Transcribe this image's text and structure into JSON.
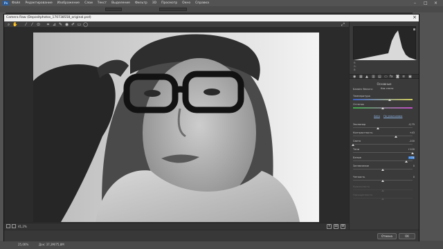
{
  "photoshop": {
    "logo": "Ps",
    "menu": [
      "Файл",
      "Редактирование",
      "Изображение",
      "Слои",
      "Текст",
      "Выделение",
      "Фильтр",
      "3D",
      "Просмотр",
      "Окно",
      "Справка"
    ],
    "status": {
      "zoom": "25,06%",
      "doc": "Док: 37,3M/75,8M"
    }
  },
  "camera_raw": {
    "title": "Camera Raw (Depositphotos_170738558_original.psd)",
    "zoom": "41,2%",
    "panel_heading": "Основные",
    "white_balance": {
      "label": "Баланс белого:",
      "value": "Как снято"
    },
    "links": {
      "auto": "Авто",
      "default": "По умолчанию"
    },
    "sliders": [
      {
        "label": "Температура",
        "value": "",
        "pos": 0.62,
        "gradient": "linear-gradient(to right,#3f63c8,#d6d25c)"
      },
      {
        "label": "Оттенок",
        "value": "",
        "pos": 0.5,
        "gradient": "linear-gradient(to right,#3fae4a,#c24cc8)"
      },
      {
        "label": "Экспонир",
        "value": "-0,75",
        "pos": 0.42
      },
      {
        "label": "Контрастность",
        "value": "+43",
        "pos": 0.72
      },
      {
        "label": "Света",
        "value": "-100",
        "pos": 0.0
      },
      {
        "label": "Тени",
        "value": "+100",
        "pos": 1.0
      },
      {
        "label": "Белые",
        "value": "+78",
        "pos": 0.89,
        "highlight": true
      },
      {
        "label": "Затемнение",
        "value": "0",
        "pos": 0.5
      },
      {
        "label": "Четкость",
        "value": "0",
        "pos": 0.5
      },
      {
        "label": "Красочность",
        "value": "",
        "pos": 0.5,
        "disabled": true
      },
      {
        "label": "Насыщенность",
        "value": "",
        "pos": 0.5,
        "disabled": true
      }
    ],
    "histogram_readout": [
      "R:",
      "G:",
      "B:"
    ],
    "buttons": {
      "cancel": "Отмена",
      "ok": "OK"
    }
  }
}
